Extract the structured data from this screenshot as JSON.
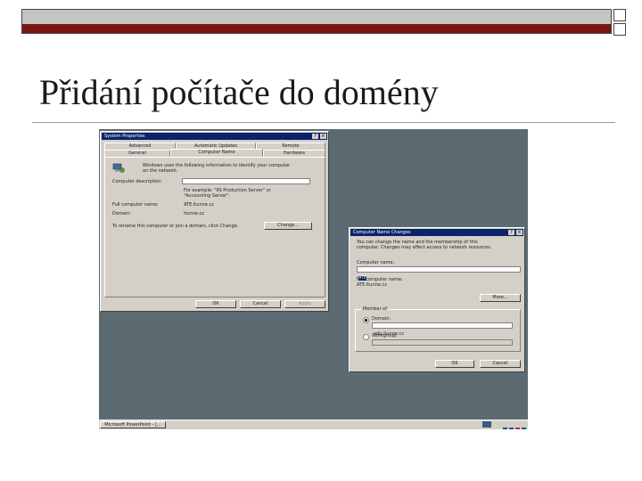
{
  "slide": {
    "title": "Přidání počítače do domény"
  },
  "system_properties": {
    "title": "System Properties",
    "tabs_row1": [
      "Advanced",
      "Automatic Updates",
      "Remote"
    ],
    "tabs_row2": [
      "General",
      "Computer Name",
      "Hardware"
    ],
    "info_line1": "Windows uses the following information to identify your computer",
    "info_line2": "on the network.",
    "description_label": "Computer description:",
    "example_line1": "For example: \"IIS Production Server\" or",
    "example_line2": "\"Accounting Server\".",
    "full_name_label": "Full computer name:",
    "full_name_value": "ATE.Itunne.cz",
    "domain_label": "Domain:",
    "domain_value": "itunne.cz",
    "rename_text": "To rename this computer or join a domain, click Change.",
    "change_button": "Change...",
    "ok_button": "OK",
    "cancel_button": "Cancel",
    "apply_button": "Apply"
  },
  "name_change": {
    "title": "Computer Name Changes",
    "info_line1": "You can change the name and the membership of this",
    "info_line2": "computer. Changes may affect access to network resources.",
    "name_label": "Computer name:",
    "name_value": "ATE",
    "full_label": "Full computer name:",
    "full_value": "ATE.Itunne.cz",
    "more_button": "More...",
    "member_group": "Member of",
    "domain_radio": "Domain:",
    "domain_value": "edu.itunne.cz",
    "workgroup_radio": "Workgroup:",
    "ok_button": "OK",
    "cancel_button": "Cancel"
  },
  "taskbar": {
    "task_label": "Microsoft PowerPoint - [..."
  },
  "colors": {
    "accent_dark_red": "#7a1616",
    "desktop": "#5c6b72",
    "title_bar": "#0a246a",
    "dialog_face": "#d4d0c8"
  }
}
